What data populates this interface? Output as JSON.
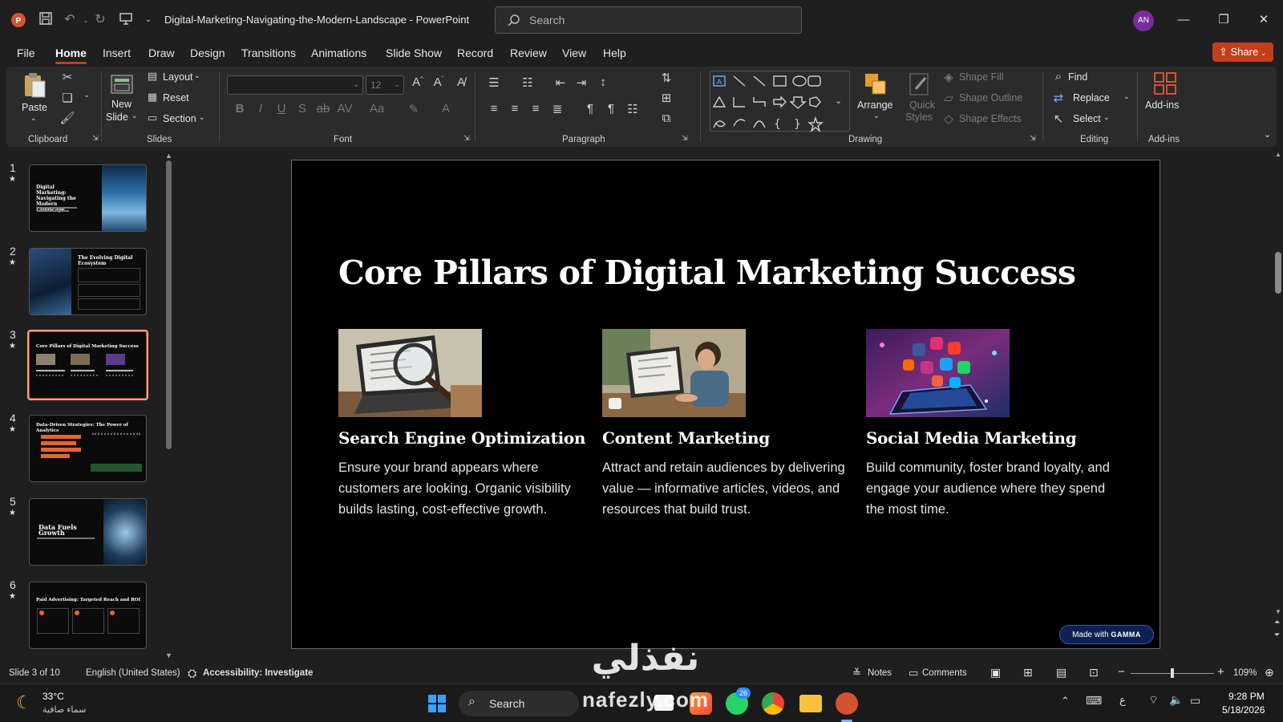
{
  "titlebar": {
    "doc_title": "Digital-Marketing-Navigating-the-Modern-Landscape  -  PowerPoint",
    "search_placeholder": "Search",
    "avatar_initials": "AN"
  },
  "menu": {
    "tabs": [
      "File",
      "Home",
      "Insert",
      "Draw",
      "Design",
      "Transitions",
      "Animations",
      "Slide Show",
      "Record",
      "Review",
      "View",
      "Help"
    ],
    "active": "Home",
    "share_label": "Share"
  },
  "ribbon": {
    "clipboard": {
      "paste": "Paste",
      "label": "Clipboard"
    },
    "slides": {
      "new_slide_1": "New",
      "new_slide_2": "Slide",
      "layout": "Layout",
      "reset": "Reset",
      "section": "Section",
      "label": "Slides"
    },
    "font": {
      "size": "12",
      "label": "Font"
    },
    "paragraph": {
      "label": "Paragraph"
    },
    "drawing": {
      "arrange": "Arrange",
      "quick_styles_1": "Quick",
      "quick_styles_2": "Styles",
      "shape_fill": "Shape Fill",
      "shape_outline": "Shape Outline",
      "shape_effects": "Shape Effects",
      "label": "Drawing"
    },
    "editing": {
      "find": "Find",
      "replace": "Replace",
      "select": "Select",
      "label": "Editing"
    },
    "addins": {
      "button": "Add-ins",
      "label": "Add-ins"
    }
  },
  "thumbnails": [
    {
      "num": "1",
      "title": "Digital Marketing: Navigating the Modern Landscape"
    },
    {
      "num": "2",
      "title": "The Evolving Digital Ecosystem"
    },
    {
      "num": "3",
      "title": "Core Pillars of Digital Marketing Success"
    },
    {
      "num": "4",
      "title": "Data-Driven Strategies: The Power of Analytics"
    },
    {
      "num": "5",
      "title": "Data Fuels Growth"
    },
    {
      "num": "6",
      "title": "Paid Advertising: Targeted Reach and ROI"
    }
  ],
  "slide": {
    "title": "Core Pillars of Digital Marketing Success",
    "cards": [
      {
        "heading": "Search Engine Optimization",
        "body": "Ensure your brand appears where customers are looking. Organic visibility builds lasting, cost-effective growth."
      },
      {
        "heading": "Content Marketing",
        "body": "Attract and retain audiences by delivering value — informative articles, videos, and resources that build trust."
      },
      {
        "heading": "Social Media Marketing",
        "body": "Build community, foster brand loyalty, and engage your audience where they spend the most time."
      }
    ],
    "badge_prefix": "Made with",
    "badge_brand": "GAMMA"
  },
  "statusbar": {
    "slide_count": "Slide 3 of 10",
    "language": "English (United States)",
    "accessibility": "Accessibility: Investigate",
    "notes": "Notes",
    "comments": "Comments",
    "zoom": "109%"
  },
  "taskbar": {
    "temperature": "33°C",
    "weather_text": "سماء صافية",
    "search": "Search",
    "whatsapp_badge": "26",
    "lang": "ع",
    "time": "9:28 PM",
    "date": "5/18/2026"
  },
  "watermark": {
    "arabic": "نفذلي",
    "latin": "nafezly.com"
  },
  "colors": {
    "accent": "#c43e1c",
    "slide_bg": "#000000",
    "ribbon_bg": "#2b2b2b",
    "window_bg": "#1f1f1f"
  }
}
